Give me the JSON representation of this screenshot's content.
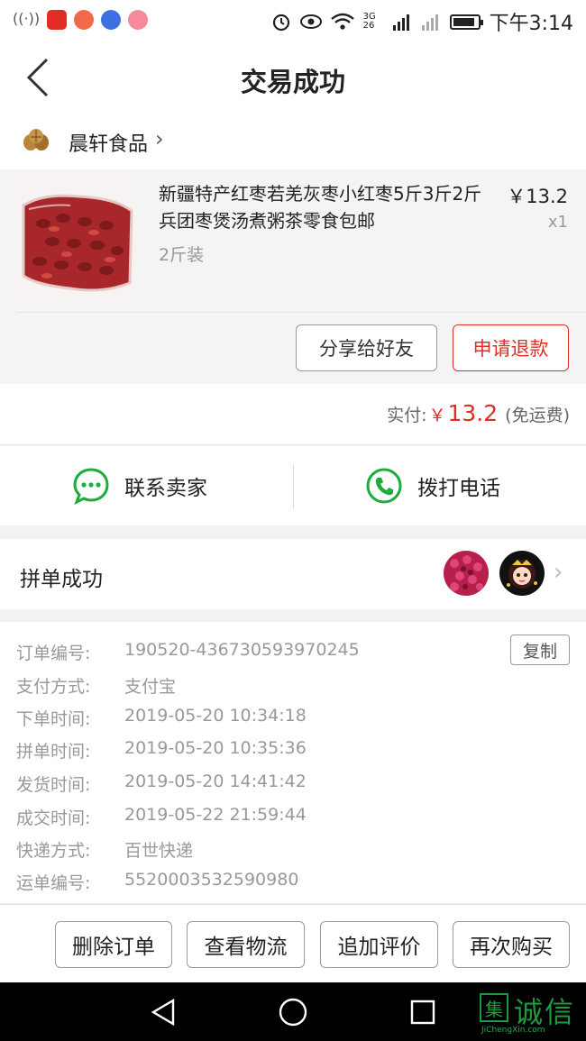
{
  "status_bar": {
    "time": "下午3:14",
    "network": "3G 26",
    "battery_level": 0.9
  },
  "header": {
    "title": "交易成功"
  },
  "shop": {
    "name": "晨轩食品"
  },
  "product": {
    "title": "新疆特产红枣若羌灰枣小红枣5斤3斤2斤兵团枣煲汤煮粥茶零食包邮",
    "spec": "2斤装",
    "price": "￥13.2",
    "quantity": "x1"
  },
  "product_actions": {
    "share": "分享给好友",
    "refund": "申请退款"
  },
  "payment": {
    "label": "实付:",
    "currency": "￥",
    "amount": "13.2",
    "note": "(免运费)"
  },
  "contact": {
    "seller": "联系卖家",
    "call": "拨打电话"
  },
  "group": {
    "label": "拼单成功"
  },
  "order_info": {
    "copy_label": "复制",
    "rows": [
      {
        "key": "订单编号:",
        "value": "190520-436730593970245"
      },
      {
        "key": "支付方式:",
        "value": "支付宝"
      },
      {
        "key": "下单时间:",
        "value": "2019-05-20 10:34:18"
      },
      {
        "key": "拼单时间:",
        "value": "2019-05-20 10:35:36"
      },
      {
        "key": "发货时间:",
        "value": "2019-05-20 14:41:42"
      },
      {
        "key": "成交时间:",
        "value": "2019-05-22 21:59:44"
      },
      {
        "key": "快递方式:",
        "value": "百世快递"
      },
      {
        "key": "运单编号:",
        "value": "5520003532590980"
      }
    ]
  },
  "bottom_actions": [
    "删除订单",
    "查看物流",
    "追加评价",
    "再次购买"
  ],
  "watermark": {
    "logo": "集",
    "text": "诚信",
    "url": "JiChengXin.com"
  },
  "colors": {
    "accent_red": "#e02e24",
    "wechat_green": "#1aad3a",
    "watermark_green": "#1a9c3e"
  }
}
